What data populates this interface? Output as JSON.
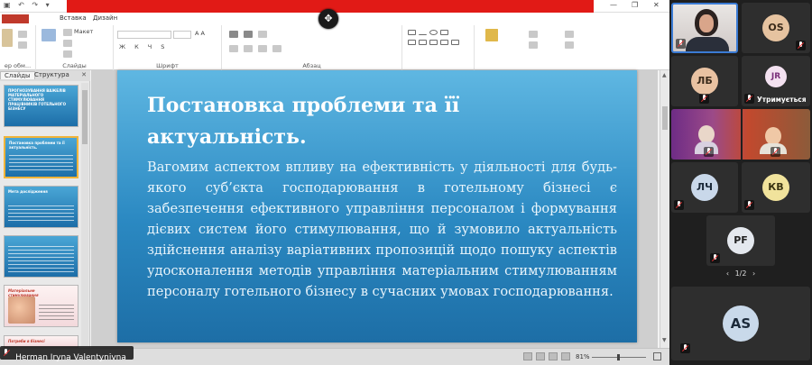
{
  "ppt": {
    "ribbon_tabs": [
      "Вставка",
      "Дизайн"
    ],
    "font_group_label": "Шрифт",
    "paragraph_group_label": "Абзац",
    "slides_group_label": "Слайды",
    "clipboard_group_label": "ер обм...",
    "layout_label": "Макет",
    "pane_tabs": [
      "Слайды",
      "Структура"
    ],
    "thumbnails": [
      {
        "title": "ПРОГНОЗУВАННЯ ВАЖЕЛІВ\nМАТЕРІАЛЬНОГО\nСТИМУЛЮВАННЯ\nПРАЦІВНИКІВ ГОТЕЛЬНОГО\nБІЗНЕСУ"
      },
      {
        "title": "Постановка проблеми та її\nактуальність."
      },
      {
        "title": "Мета дослідження"
      },
      {
        "title": ""
      },
      {
        "title": "Матеріальне\nстимулювання"
      },
      {
        "title": "Потреби в бізнесі"
      }
    ],
    "slide": {
      "title": "Постановка проблеми та її актуальність.",
      "body": "Вагомим аспектом впливу на ефективність у діяльності для будь-якого суб’єкта господарювання в готельному бізнесі є забезпечення ефективного управління персоналом і формування дієвих систем його стимулювання, що й зумовило актуальність здійснення аналізу варіативних пропозицій щодо пошуку аспектів удосконалення методів управління матеріальним стимулюванням персоналу готельного бізнесу в сучасних умовах господарювання."
    },
    "zoom": "81%",
    "presenter_name": "Herman Iryna Valentynivna"
  },
  "gallery": {
    "participants": [
      {
        "initials": "",
        "kind": "video-woman"
      },
      {
        "initials": "OS",
        "bg": "#e6c3a0",
        "fg": "#3a2a1a"
      },
      {
        "initials": "ЛБ",
        "bg": "#e9c2a2",
        "fg": "#3a2a1a"
      },
      {
        "initials": "JR",
        "bg": "#f3e1f0",
        "fg": "#7a2f7a",
        "label": "Утримується"
      },
      {
        "initials": "",
        "kind": "video-room"
      },
      {
        "initials": "ЛЧ",
        "bg": "#c9d8ea",
        "fg": "#1c2a3a"
      },
      {
        "initials": "КВ",
        "bg": "#f1e39c",
        "fg": "#3a3412"
      },
      {
        "initials": "PF",
        "bg": "#e4e8ee",
        "fg": "#222"
      },
      {
        "initials": "AS",
        "bg": "#c9d9ea",
        "fg": "#1c2a3a"
      }
    ],
    "pager": "1/2"
  }
}
